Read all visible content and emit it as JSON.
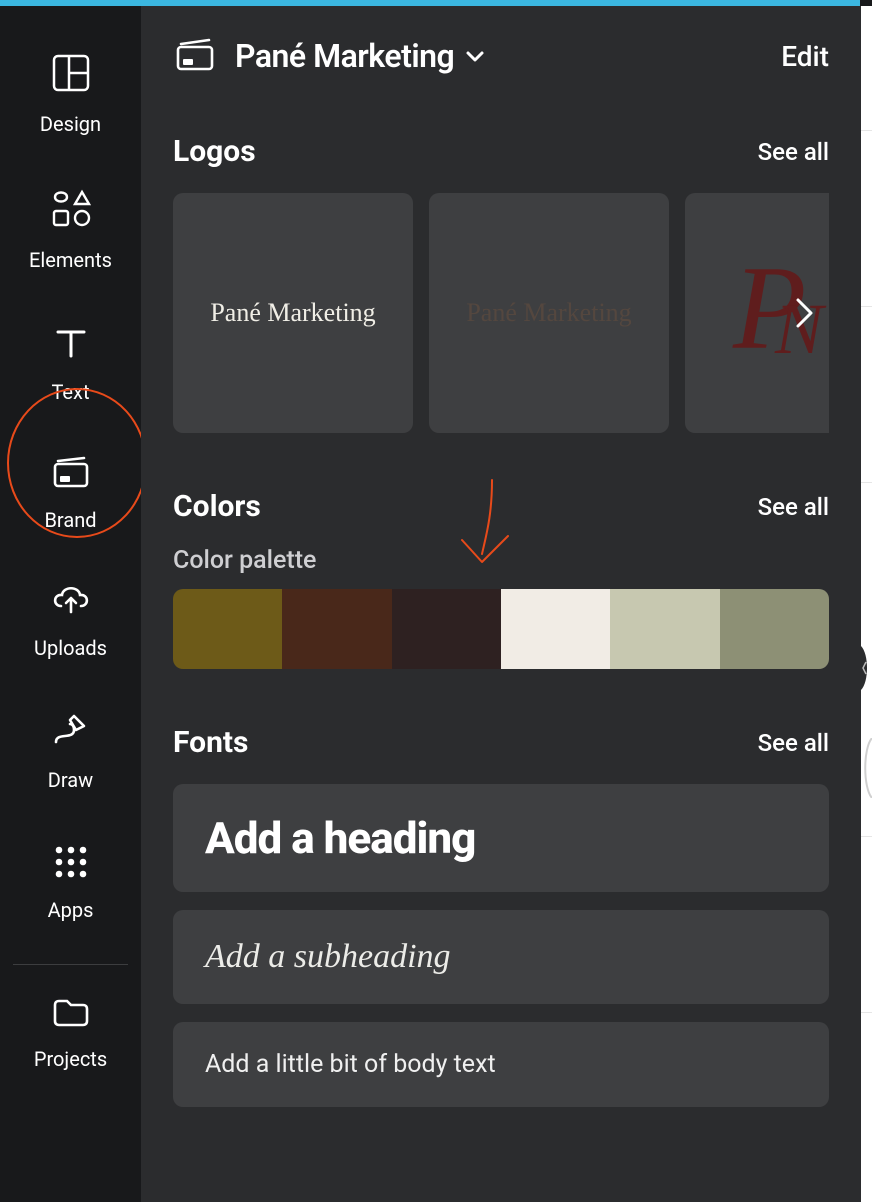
{
  "header": {
    "brand_name": "Pané Marketing",
    "edit_label": "Edit"
  },
  "sidebar": {
    "items": [
      {
        "label": "Design"
      },
      {
        "label": "Elements"
      },
      {
        "label": "Text"
      },
      {
        "label": "Brand"
      },
      {
        "label": "Uploads"
      },
      {
        "label": "Draw"
      },
      {
        "label": "Apps"
      },
      {
        "label": "Projects"
      }
    ]
  },
  "sections": {
    "logos": {
      "title": "Logos",
      "see_all": "See all",
      "items": [
        {
          "text": "Pané Marketing",
          "fg": "#f0eee6",
          "bg": "#3e3f41"
        },
        {
          "text": "Pané Marketing",
          "fg": "#54473f",
          "bg": "#3e3f41"
        },
        {
          "monogram": true,
          "fg": "#5f1d1d",
          "bg": "#3e3f41"
        }
      ]
    },
    "colors": {
      "title": "Colors",
      "see_all": "See all",
      "palette_label": "Color palette",
      "palette": [
        "#6d5a18",
        "#49281a",
        "#2e2121",
        "#f1ece5",
        "#c7c8b0",
        "#8d9075"
      ]
    },
    "fonts": {
      "title": "Fonts",
      "see_all": "See all",
      "heading_text": "Add a heading",
      "subheading_text": "Add a subheading",
      "body_text": "Add a little bit of body text"
    }
  }
}
